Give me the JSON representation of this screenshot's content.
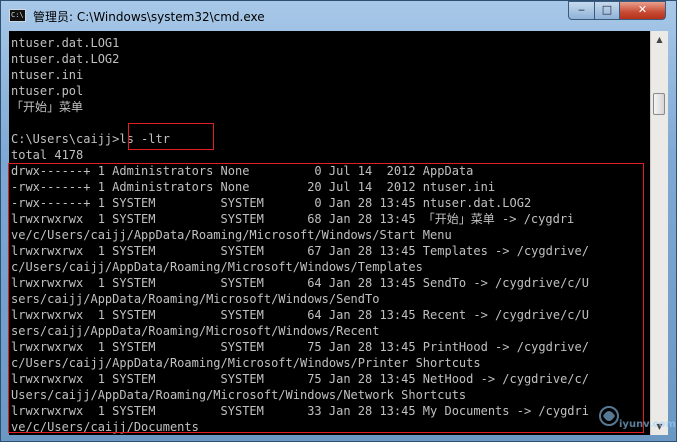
{
  "window": {
    "title": "管理员: C:\\Windows\\system32\\cmd.exe",
    "icon_label": "C:\\",
    "controls": {
      "minimize": "‒",
      "maximize": "□",
      "close": "✕"
    }
  },
  "terminal": {
    "lines": [
      "ntuser.dat.LOG1",
      "ntuser.dat.LOG2",
      "ntuser.ini",
      "ntuser.pol",
      "「开始」菜单",
      "",
      "C:\\Users\\caijj>ls -ltr",
      "total 4178",
      "drwx------+ 1 Administrators None         0 Jul 14  2012 AppData",
      "-rwx------+ 1 Administrators None        20 Jul 14  2012 ntuser.ini",
      "-rwx------+ 1 SYSTEM         SYSTEM       0 Jan 28 13:45 ntuser.dat.LOG2",
      "lrwxrwxrwx  1 SYSTEM         SYSTEM      68 Jan 28 13:45 「开始」菜单 -> /cygdri",
      "ve/c/Users/caijj/AppData/Roaming/Microsoft/Windows/Start Menu",
      "lrwxrwxrwx  1 SYSTEM         SYSTEM      67 Jan 28 13:45 Templates -> /cygdrive/",
      "c/Users/caijj/AppData/Roaming/Microsoft/Windows/Templates",
      "lrwxrwxrwx  1 SYSTEM         SYSTEM      64 Jan 28 13:45 SendTo -> /cygdrive/c/U",
      "sers/caijj/AppData/Roaming/Microsoft/Windows/SendTo",
      "lrwxrwxrwx  1 SYSTEM         SYSTEM      64 Jan 28 13:45 Recent -> /cygdrive/c/U",
      "sers/caijj/AppData/Roaming/Microsoft/Windows/Recent",
      "lrwxrwxrwx  1 SYSTEM         SYSTEM      75 Jan 28 13:45 PrintHood -> /cygdrive/",
      "c/Users/caijj/AppData/Roaming/Microsoft/Windows/Printer Shortcuts",
      "lrwxrwxrwx  1 SYSTEM         SYSTEM      75 Jan 28 13:45 NetHood -> /cygdrive/c/",
      "Users/caijj/AppData/Roaming/Microsoft/Windows/Network Shortcuts",
      "lrwxrwxrwx  1 SYSTEM         SYSTEM      33 Jan 28 13:45 My Documents -> /cygdri",
      "ve/c/Users/caijj/Documents"
    ]
  },
  "scrollbar": {
    "up_arrow": "▲",
    "down_arrow": "▼"
  },
  "watermark": {
    "text": "iyunv.com"
  },
  "colors": {
    "console_bg": "#000000",
    "console_fg": "#c0c0c0",
    "highlight": "#e02020"
  }
}
